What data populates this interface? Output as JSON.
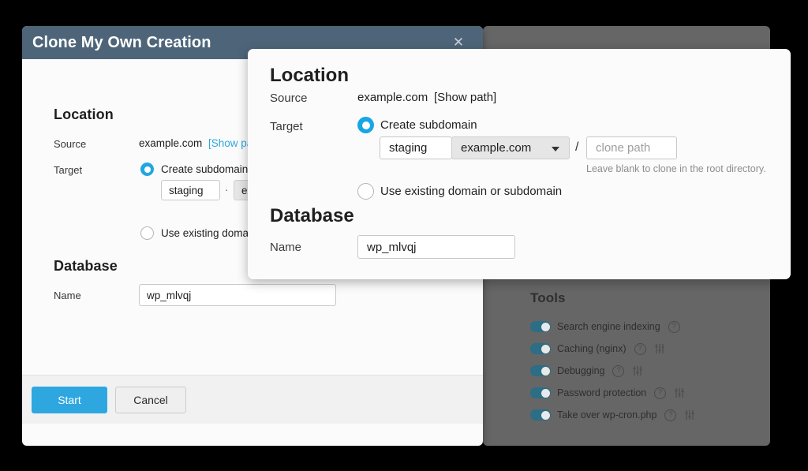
{
  "window": {
    "title": "Clone My Own Creation",
    "close_icon": "close-icon"
  },
  "location": {
    "heading": "Location",
    "source_label": "Source",
    "source_value": "example.com",
    "show_path_link": "[Show path]",
    "target_label": "Target",
    "create_subdomain_label": "Create subdomain",
    "subdomain_value": "staging",
    "separator_dot": "·",
    "domain_selected": "example.com",
    "path_separator": "/",
    "clone_path_placeholder": "clone path",
    "clone_path_value": "",
    "clone_path_hint": "Leave blank to clone in the root directory.",
    "use_existing_label": "Use existing domain or subdomain"
  },
  "database": {
    "heading": "Database",
    "name_label": "Name",
    "name_value": "wp_mlvqj"
  },
  "footer": {
    "start_label": "Start",
    "cancel_label": "Cancel"
  },
  "tools": {
    "heading": "Tools",
    "items": [
      {
        "label": "Search engine indexing",
        "enabled": true,
        "has_help": true,
        "has_settings": false
      },
      {
        "label": "Caching (nginx)",
        "enabled": true,
        "has_help": true,
        "has_settings": true
      },
      {
        "label": "Debugging",
        "enabled": true,
        "has_help": true,
        "has_settings": true
      },
      {
        "label": "Password protection",
        "enabled": true,
        "has_help": true,
        "has_settings": true
      },
      {
        "label": "Take over wp-cron.php",
        "enabled": true,
        "has_help": true,
        "has_settings": true
      }
    ],
    "help_glyph": "?"
  },
  "colors": {
    "titlebar": "#4e6579",
    "accent": "#2ea7e0",
    "link": "#2ea7e0",
    "overlay": "#666666",
    "toggle_on": "#2b6e85",
    "dialog_bg": "#fbfbfb",
    "footer_bg": "#f1f1f1"
  }
}
